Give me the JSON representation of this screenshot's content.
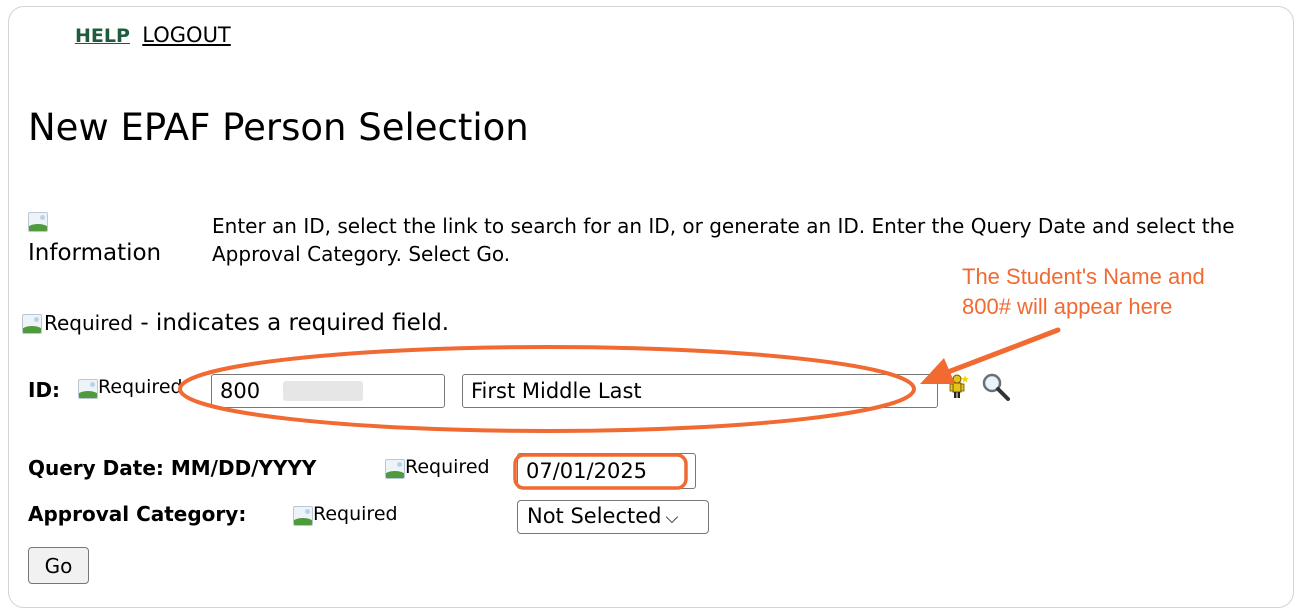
{
  "links": {
    "help": "HELP",
    "logout": "LOGOUT"
  },
  "page": {
    "title": "New EPAF Person Selection"
  },
  "info": {
    "image_alt": "Information",
    "text": "Enter an ID, select the link to search for an ID, or generate an ID. Enter the Query Date and select the Approval Category. Select Go."
  },
  "required_note": {
    "image_alt": "Required",
    "text": " - indicates a required field."
  },
  "form": {
    "id_label": "ID:",
    "id_required_alt": "Required",
    "id_value": "800",
    "name_value": "First Middle Last",
    "query_date_label": "Query Date: MM/DD/YYYY",
    "query_date_required_alt": "Required",
    "query_date_value": "07/01/2025",
    "approval_label": "Approval Category:",
    "approval_required_alt": "Required",
    "approval_selected": "Not Selected",
    "go_label": "Go"
  },
  "annotation": {
    "line1": "The Student's Name and",
    "line2": "800# will appear here",
    "color": "#f06a32"
  },
  "icons": [
    "person-generate-icon",
    "search-icon",
    "broken-image-icon"
  ]
}
